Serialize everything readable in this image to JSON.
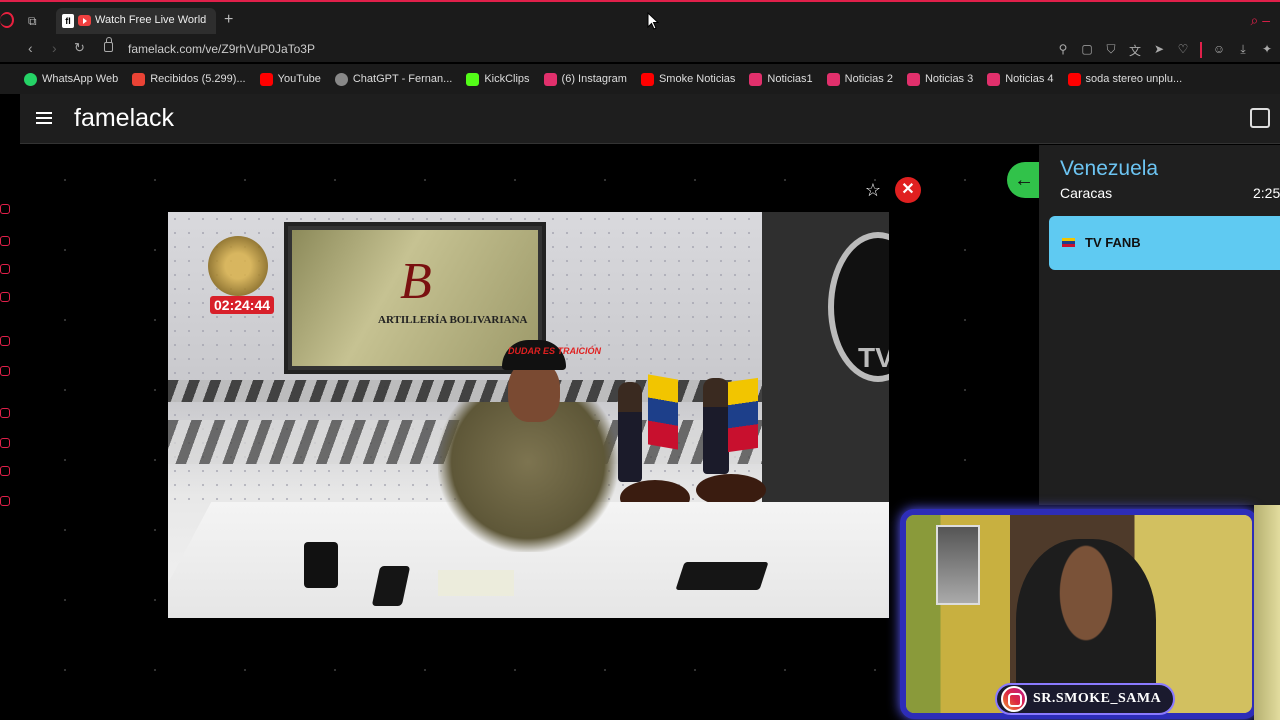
{
  "browser": {
    "tab_title": "Watch Free Live World",
    "url": "famelack.com/ve/Z9rhVuP0JaTo3P",
    "bookmarks": [
      {
        "label": "WhatsApp Web",
        "icon": "whatsapp-icon",
        "color": "#25d366"
      },
      {
        "label": "Recibidos (5.299)...",
        "icon": "gmail-icon",
        "color": "#ea4335"
      },
      {
        "label": "YouTube",
        "icon": "youtube-icon",
        "color": "#ff0000"
      },
      {
        "label": "ChatGPT - Fernan...",
        "icon": "chatgpt-icon",
        "color": "#cccccc"
      },
      {
        "label": "KickClips",
        "icon": "kick-icon",
        "color": "#53fc18"
      },
      {
        "label": "(6) Instagram",
        "icon": "instagram-icon",
        "color": "#e1306c"
      },
      {
        "label": "Smoke Noticias",
        "icon": "youtube-icon",
        "color": "#ff0000"
      },
      {
        "label": "Noticias1",
        "icon": "instagram-icon",
        "color": "#e1306c"
      },
      {
        "label": "Noticias 2",
        "icon": "instagram-icon",
        "color": "#e1306c"
      },
      {
        "label": "Noticias 3",
        "icon": "instagram-icon",
        "color": "#e1306c"
      },
      {
        "label": "Noticias 4",
        "icon": "instagram-icon",
        "color": "#e1306c"
      },
      {
        "label": "soda stereo unplu...",
        "icon": "youtube-icon",
        "color": "#ff0000"
      }
    ]
  },
  "site": {
    "logo": "famelack"
  },
  "video": {
    "clock": "02:24:44",
    "frame_text": "ARTILLERÍA BOLIVARIANA",
    "cap_text": "DUDAR ES TRAICIÓN",
    "tv_text": "TV"
  },
  "panel": {
    "country": "Venezuela",
    "city": "Caracas",
    "time": "2:25",
    "channel": "TV FANB"
  },
  "overlay": {
    "handle": "SR.SMOKE_SAMA"
  }
}
